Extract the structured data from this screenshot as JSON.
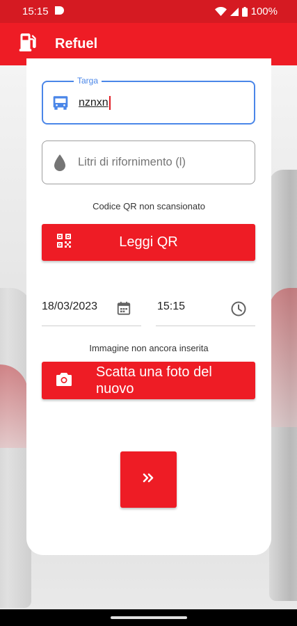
{
  "status_bar": {
    "time": "15:15",
    "battery": "100%"
  },
  "app_bar": {
    "title": "Refuel",
    "icon": "fuel-pump-icon"
  },
  "form": {
    "targa": {
      "label": "Targa",
      "value": "nznxn",
      "icon": "truck-icon"
    },
    "litri": {
      "placeholder": "Litri di rifornimento (l)",
      "icon": "water-drop-icon"
    },
    "qr_status": "Codice QR non scansionato",
    "qr_button": {
      "label": "Leggi QR",
      "icon": "qr-code-icon"
    },
    "date": {
      "value": "18/03/2023",
      "icon": "calendar-icon"
    },
    "time": {
      "value": "15:15",
      "icon": "clock-icon"
    },
    "image_status": "Immagine non ancora inserita",
    "photo_button": {
      "label": "Scatta una foto del nuovo",
      "icon": "camera-icon"
    },
    "next_button": {
      "icon": "double-chevron-right-icon"
    }
  },
  "colors": {
    "primary": "#ee1c25",
    "status_bar": "#d51a22",
    "focus": "#4a86e8"
  }
}
